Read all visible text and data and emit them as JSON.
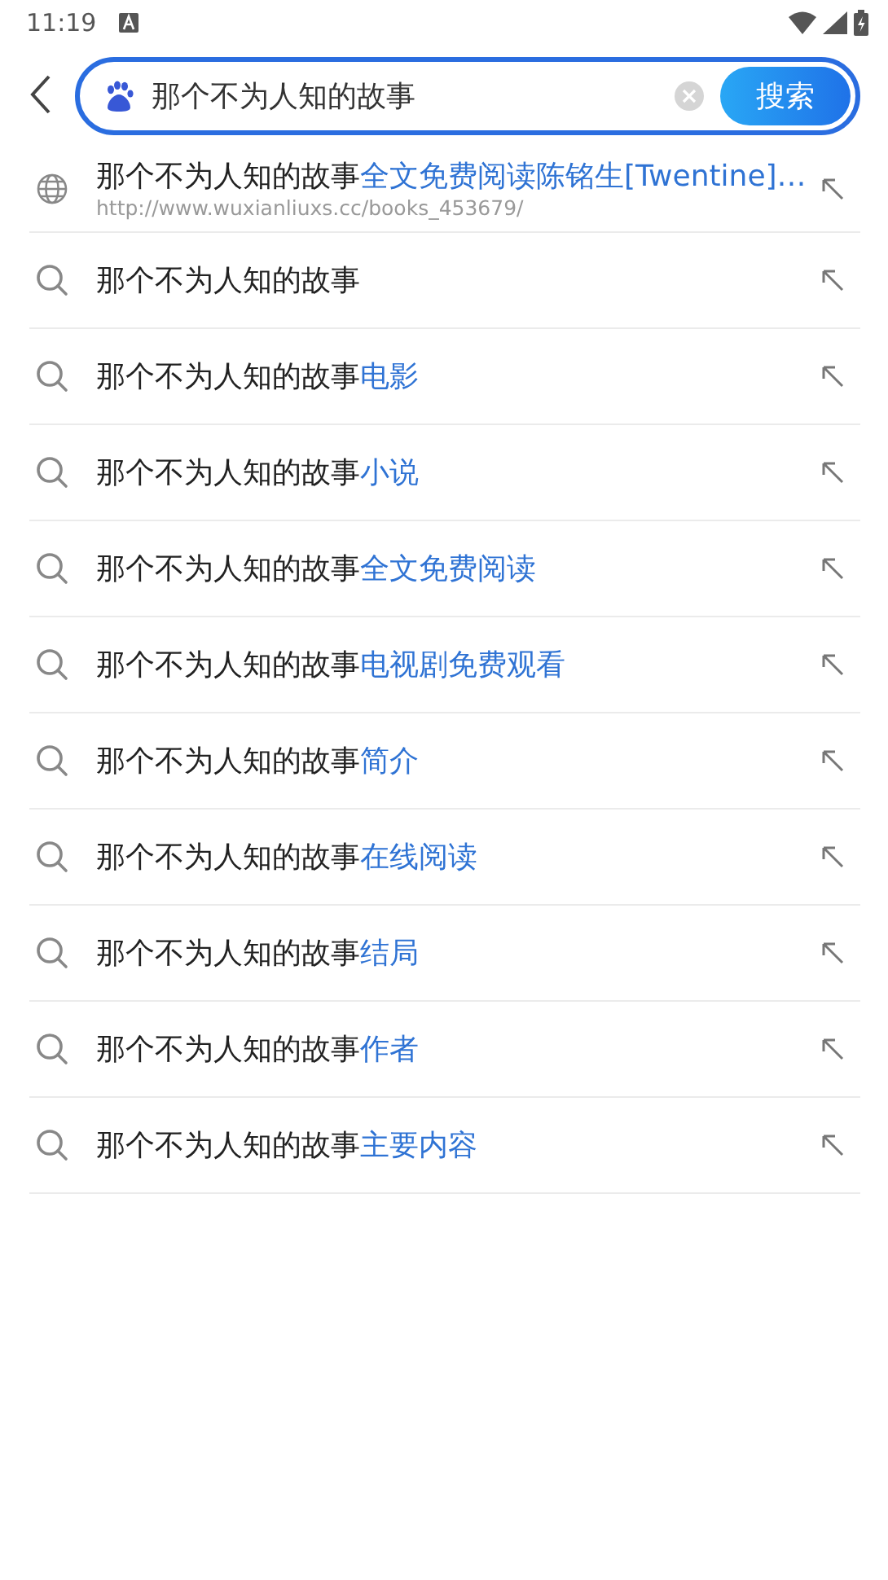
{
  "status_bar": {
    "time": "11:19"
  },
  "search": {
    "value": "那个不为人知的故事",
    "button": "搜索"
  },
  "suggestions": [
    {
      "kind": "web",
      "query": "那个不为人知的故事",
      "suffix": "全文免费阅读陈铭生[Twentine]…",
      "url": "http://www.wuxianliuxs.cc/books_453679/"
    },
    {
      "kind": "query",
      "query": "那个不为人知的故事"
    },
    {
      "kind": "query",
      "query": "那个不为人知的故事",
      "suffix": "电影"
    },
    {
      "kind": "query",
      "query": "那个不为人知的故事",
      "suffix": "小说"
    },
    {
      "kind": "query",
      "query": "那个不为人知的故事",
      "suffix": "全文免费阅读"
    },
    {
      "kind": "query",
      "query": "那个不为人知的故事",
      "suffix": "电视剧免费观看"
    },
    {
      "kind": "query",
      "query": "那个不为人知的故事",
      "suffix": "简介"
    },
    {
      "kind": "query",
      "query": "那个不为人知的故事",
      "suffix": "在线阅读"
    },
    {
      "kind": "query",
      "query": "那个不为人知的故事",
      "suffix": "结局"
    },
    {
      "kind": "query",
      "query": "那个不为人知的故事",
      "suffix": "作者"
    },
    {
      "kind": "query",
      "query": "那个不为人知的故事",
      "suffix": "主要内容"
    }
  ]
}
